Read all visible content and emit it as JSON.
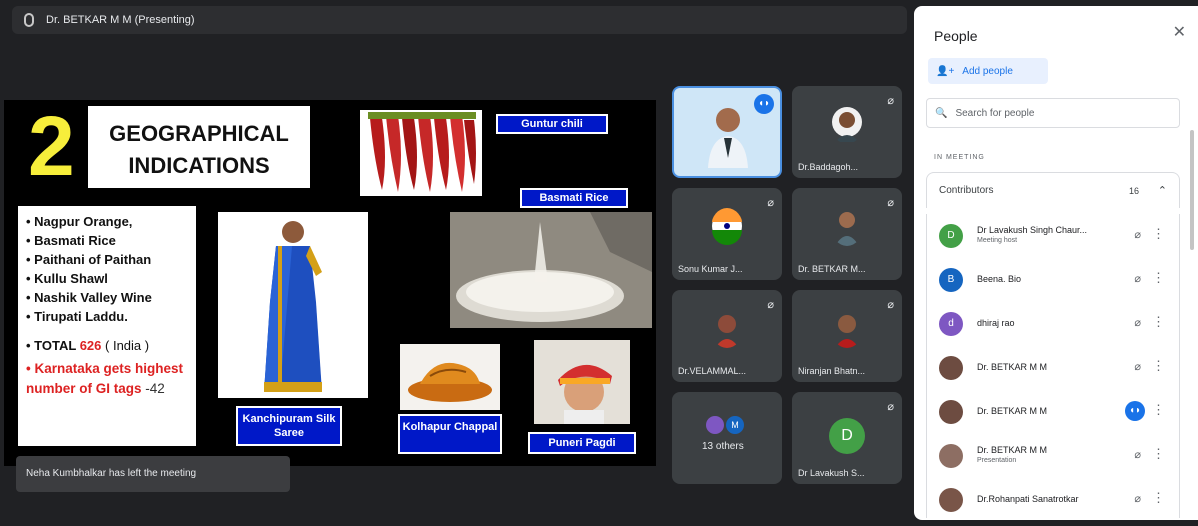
{
  "presenting_bar": {
    "title": "Dr. BETKAR M M (Presenting)"
  },
  "slide": {
    "number": "2",
    "heading_line1": "GEOGRAPHICAL",
    "heading_line2": "INDICATIONS",
    "list": [
      "Nagpur Orange,",
      "Basmati Rice",
      "Paithani of Paithan",
      "Kullu Shawl",
      "Nashik Valley Wine",
      "Tirupati Laddu."
    ],
    "total_label": "TOTAL",
    "total_value": "626",
    "total_suffix": "( India )",
    "karnataka_text": "Karnataka gets highest number of GI tags",
    "karnataka_count": "-42",
    "captions": {
      "guntur": "Guntur chili",
      "basmati": "Basmati Rice",
      "kanchipuram": "Kanchipuram Silk Saree",
      "kolhapur": "Kolhapur Chappal",
      "puneri": "Puneri Pagdi"
    }
  },
  "toast": "Neha Kumbhalkar has left the meeting",
  "tiles": [
    {
      "name": ""
    },
    {
      "name": "Dr.Baddagoh..."
    },
    {
      "name": "Sonu Kumar J..."
    },
    {
      "name": "Dr. BETKAR M..."
    },
    {
      "name": "Dr.VELAMMAL..."
    },
    {
      "name": "Niranjan Bhatn..."
    },
    {
      "name": "13 others",
      "avatars": [
        "",
        "M"
      ]
    },
    {
      "name": "Dr Lavakush S...",
      "avatar": "D"
    }
  ],
  "people": {
    "title": "People",
    "add_label": "Add people",
    "search_placeholder": "Search for people",
    "section": "IN MEETING",
    "contributors_label": "Contributors",
    "contributors_count": "16",
    "rows": [
      {
        "name": "Dr Lavakush Singh Chaur...",
        "sub": "Meeting host",
        "initial": "D",
        "color": "#43a047"
      },
      {
        "name": "Beena. Bio",
        "sub": "",
        "initial": "B",
        "color": "#1565c0"
      },
      {
        "name": "dhiraj rao",
        "sub": "",
        "initial": "d",
        "color": "#7e57c2"
      },
      {
        "name": "Dr. BETKAR M M",
        "sub": "",
        "initial": "",
        "color": "#6d4c41"
      },
      {
        "name": "Dr. BETKAR M M",
        "sub": "",
        "initial": "",
        "color": "#6d4c41"
      },
      {
        "name": "Dr. BETKAR M M",
        "sub": "Presentation",
        "initial": "",
        "color": "#8d6e63"
      },
      {
        "name": "Dr.Rohanpati Sanatrotkar",
        "sub": "",
        "initial": "",
        "color": "#795548"
      }
    ]
  }
}
